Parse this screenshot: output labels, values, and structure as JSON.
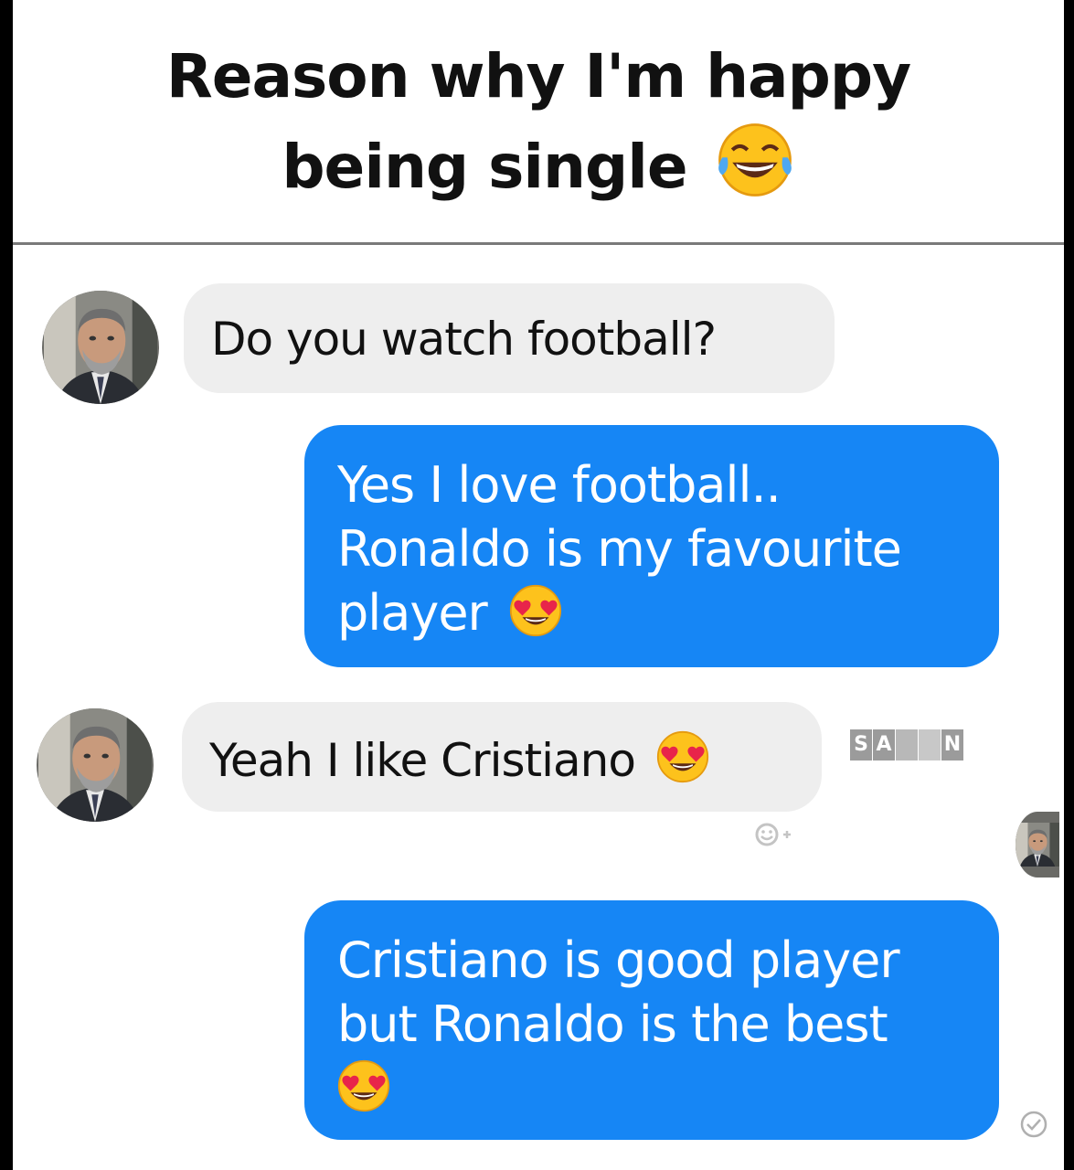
{
  "header": {
    "title": "Reason why I'm happy being single",
    "title_emoji": "face-with-tears-of-joy-icon"
  },
  "messages": [
    {
      "direction": "incoming",
      "text": "Do you watch football?"
    },
    {
      "direction": "outgoing",
      "lines": [
        "Yes I love football..",
        "Ronaldo is my favourite",
        "player"
      ],
      "trailing_emoji": "heart-eyes-icon"
    },
    {
      "direction": "incoming",
      "text": "Yeah I like Cristiano",
      "trailing_emoji": "heart-eyes-icon"
    },
    {
      "direction": "outgoing",
      "lines": [
        "Cristiano is good player",
        "but Ronaldo is the best"
      ],
      "trailing_emoji": "heart-eyes-icon"
    }
  ],
  "watermark": {
    "letters": [
      "S",
      "A",
      "",
      "",
      "N"
    ]
  },
  "colors": {
    "outgoing_bubble": "#1686f5",
    "incoming_bubble": "#eeeeee",
    "page_bg": "#ffffff",
    "frame": "#000000"
  }
}
